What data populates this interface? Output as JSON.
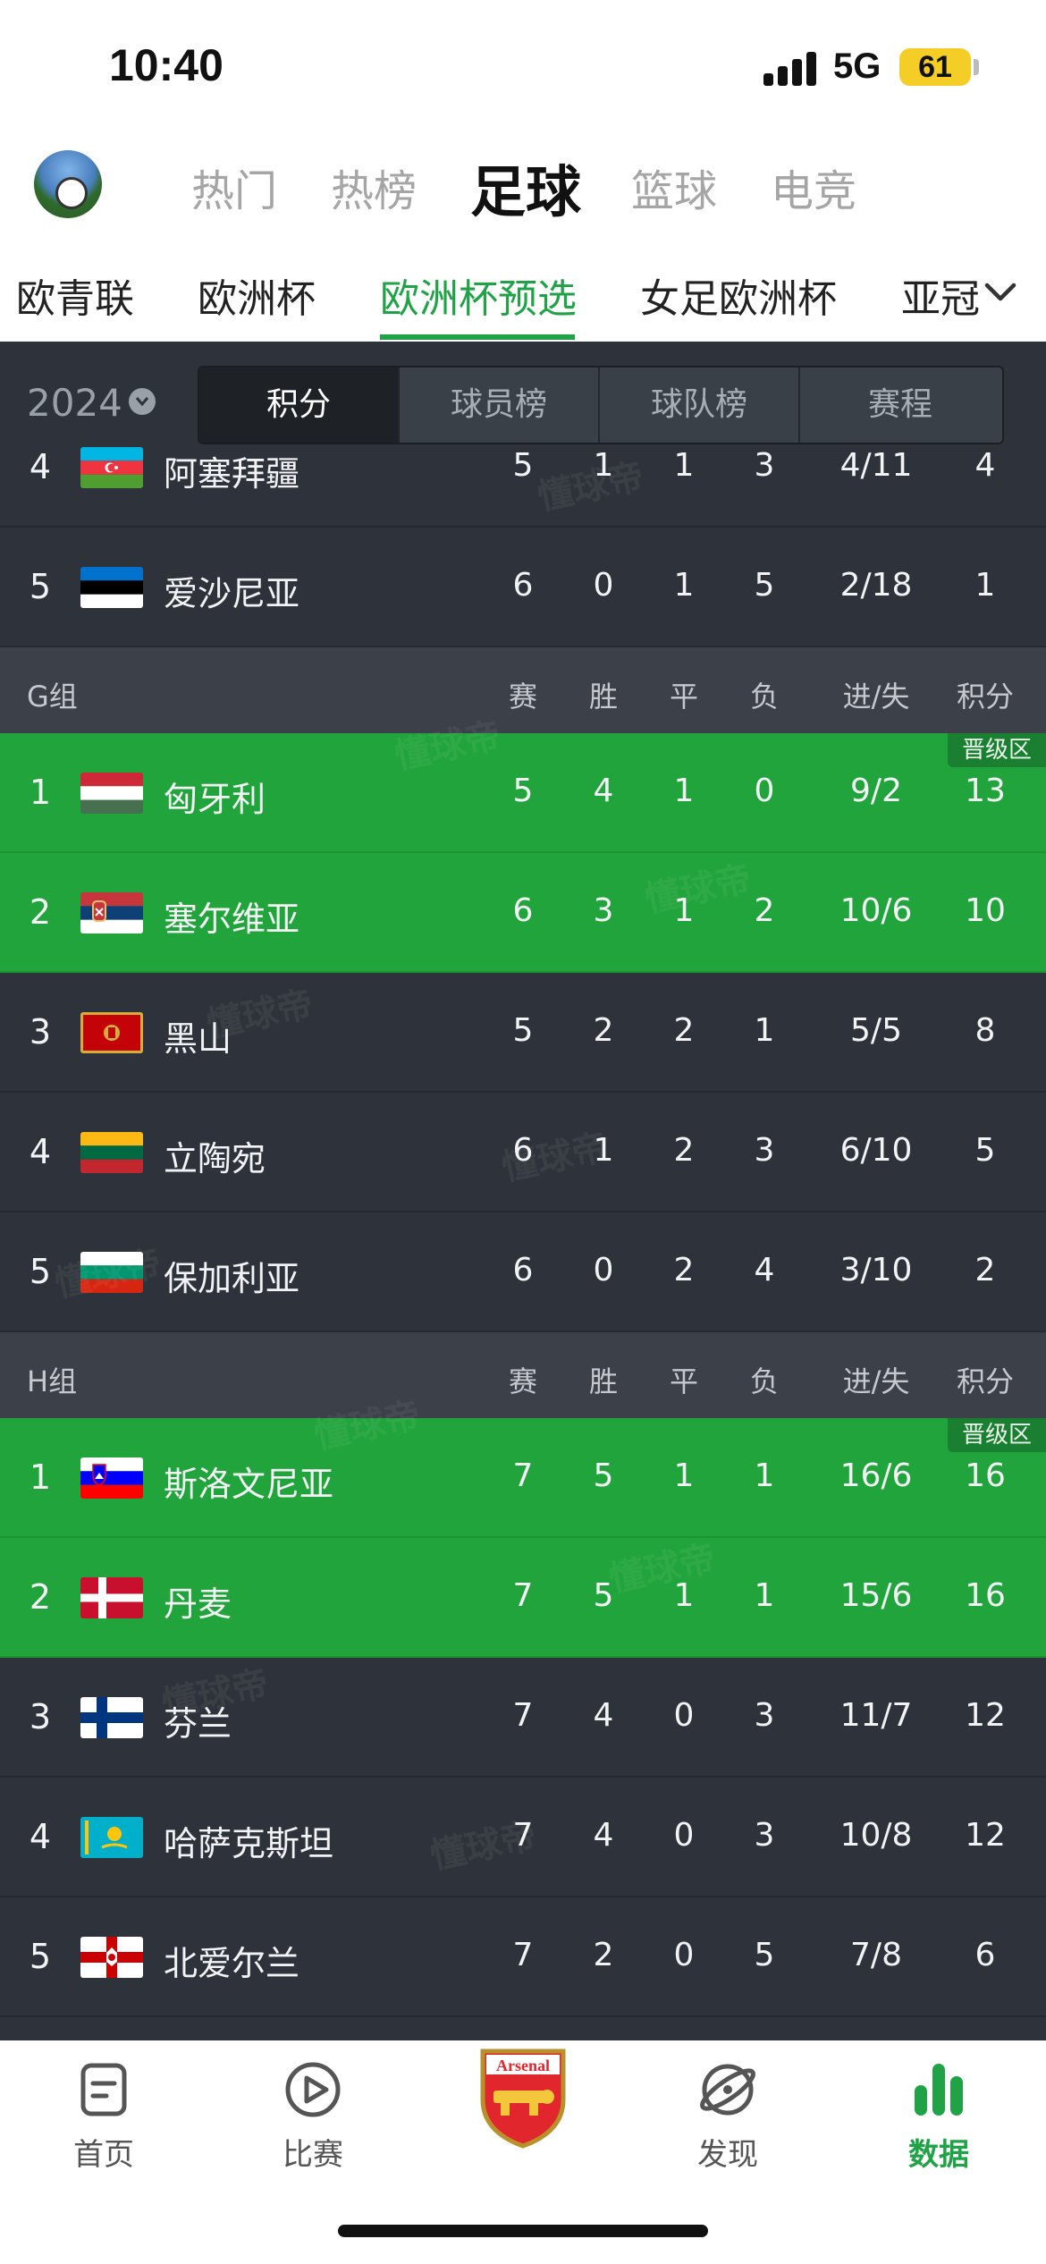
{
  "status": {
    "time": "10:40",
    "network": "5G",
    "battery": "61"
  },
  "main_tabs": [
    {
      "label": "热门",
      "active": false
    },
    {
      "label": "热榜",
      "active": false
    },
    {
      "label": "足球",
      "active": true
    },
    {
      "label": "篮球",
      "active": false
    },
    {
      "label": "电竞",
      "active": false
    }
  ],
  "sub_tabs": [
    {
      "label": "欧青联",
      "active": false
    },
    {
      "label": "欧洲杯",
      "active": false
    },
    {
      "label": "欧洲杯预选",
      "active": true
    },
    {
      "label": "女足欧洲杯",
      "active": false
    },
    {
      "label": "亚冠",
      "active": false
    }
  ],
  "season": "2024",
  "segment_tabs": [
    {
      "label": "积分",
      "active": true
    },
    {
      "label": "球员榜",
      "active": false
    },
    {
      "label": "球队榜",
      "active": false
    },
    {
      "label": "赛程",
      "active": false
    }
  ],
  "columns": {
    "played": "赛",
    "won": "胜",
    "drawn": "平",
    "lost": "负",
    "goals": "进/失",
    "points": "积分"
  },
  "promotion_label": "晋级区",
  "watermark": "懂球帝",
  "group_f_tail": [
    {
      "rank": "4",
      "team": "阿塞拜疆",
      "flag": "azerbaijan",
      "p": "5",
      "w": "1",
      "d": "1",
      "l": "3",
      "gd": "4/11",
      "pts": "4",
      "promoted": false
    },
    {
      "rank": "5",
      "team": "爱沙尼亚",
      "flag": "estonia",
      "p": "6",
      "w": "0",
      "d": "1",
      "l": "5",
      "gd": "2/18",
      "pts": "1",
      "promoted": false
    }
  ],
  "groups": [
    {
      "name": "G组",
      "rows": [
        {
          "rank": "1",
          "team": "匈牙利",
          "flag": "hungary",
          "p": "5",
          "w": "4",
          "d": "1",
          "l": "0",
          "gd": "9/2",
          "pts": "13",
          "promoted": true
        },
        {
          "rank": "2",
          "team": "塞尔维亚",
          "flag": "serbia",
          "p": "6",
          "w": "3",
          "d": "1",
          "l": "2",
          "gd": "10/6",
          "pts": "10",
          "promoted": true
        },
        {
          "rank": "3",
          "team": "黑山",
          "flag": "montenegro",
          "p": "5",
          "w": "2",
          "d": "2",
          "l": "1",
          "gd": "5/5",
          "pts": "8",
          "promoted": false
        },
        {
          "rank": "4",
          "team": "立陶宛",
          "flag": "lithuania",
          "p": "6",
          "w": "1",
          "d": "2",
          "l": "3",
          "gd": "6/10",
          "pts": "5",
          "promoted": false
        },
        {
          "rank": "5",
          "team": "保加利亚",
          "flag": "bulgaria",
          "p": "6",
          "w": "0",
          "d": "2",
          "l": "4",
          "gd": "3/10",
          "pts": "2",
          "promoted": false
        }
      ]
    },
    {
      "name": "H组",
      "rows": [
        {
          "rank": "1",
          "team": "斯洛文尼亚",
          "flag": "slovenia",
          "p": "7",
          "w": "5",
          "d": "1",
          "l": "1",
          "gd": "16/6",
          "pts": "16",
          "promoted": true
        },
        {
          "rank": "2",
          "team": "丹麦",
          "flag": "denmark",
          "p": "7",
          "w": "5",
          "d": "1",
          "l": "1",
          "gd": "15/6",
          "pts": "16",
          "promoted": true
        },
        {
          "rank": "3",
          "team": "芬兰",
          "flag": "finland",
          "p": "7",
          "w": "4",
          "d": "0",
          "l": "3",
          "gd": "11/7",
          "pts": "12",
          "promoted": false
        },
        {
          "rank": "4",
          "team": "哈萨克斯坦",
          "flag": "kazakhstan",
          "p": "7",
          "w": "4",
          "d": "0",
          "l": "3",
          "gd": "10/8",
          "pts": "12",
          "promoted": false
        },
        {
          "rank": "5",
          "team": "北爱尔兰",
          "flag": "northern-ireland",
          "p": "7",
          "w": "2",
          "d": "0",
          "l": "5",
          "gd": "7/8",
          "pts": "6",
          "promoted": false
        }
      ]
    }
  ],
  "bottom_nav": [
    {
      "label": "首页",
      "icon": "home-doc-icon",
      "active": false
    },
    {
      "label": "比赛",
      "icon": "play-icon",
      "active": false
    },
    {
      "label": "",
      "icon": "arsenal-crest-icon",
      "active": false,
      "crest_text": "Arsenal"
    },
    {
      "label": "发现",
      "icon": "discover-planet-icon",
      "active": false
    },
    {
      "label": "数据",
      "icon": "data-bars-icon",
      "active": true
    }
  ],
  "colors": {
    "accent": "#1fa346",
    "dark_bg": "#2e333b",
    "promo_row": "#21a43b"
  }
}
